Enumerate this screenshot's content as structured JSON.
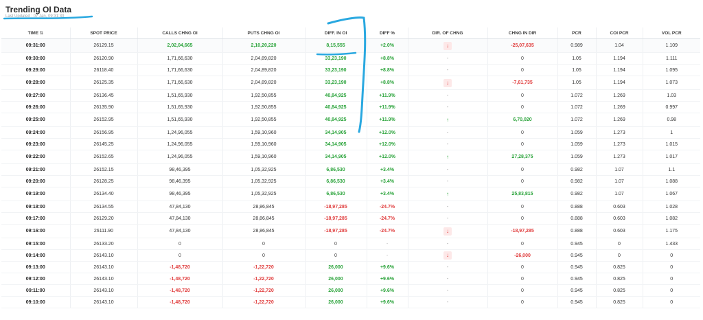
{
  "header": {
    "title": "Trending OI Data",
    "subtitle": "Last Updated : 07 Jan, 09:31:30"
  },
  "columns": [
    "TIME",
    "SPOT PRICE",
    "CALLS CHNG OI",
    "PUTS CHNG OI",
    "DIFF. IN OI",
    "DIFF %",
    "DIR. OF CHNG",
    "CHNG IN DIR",
    "PCR",
    "COI PCR",
    "VOL PCR"
  ],
  "icons": {
    "sort": "sort-icon",
    "down": "arrow-down-icon",
    "up": "arrow-up-icon"
  },
  "colors": {
    "positive": "#2aa33a",
    "negative": "#e03c3c",
    "annotation": "#29a8e0"
  },
  "rows": [
    {
      "time": "09:31:00",
      "spot": "26129.15",
      "calls": "2,02,04,665",
      "puts": "2,10,20,220",
      "diff": "8,15,555",
      "diffpct": "+2.0%",
      "dir": "down",
      "chng": "-25,07,635",
      "pcr": "0.989",
      "coi": "1.04",
      "vol": "1.109"
    },
    {
      "time": "09:30:00",
      "spot": "26120.90",
      "calls": "1,71,66,630",
      "puts": "2,04,89,820",
      "diff": "33,23,190",
      "diffpct": "+8.8%",
      "dir": "-",
      "chng": "0",
      "pcr": "1.05",
      "coi": "1.194",
      "vol": "1.111"
    },
    {
      "time": "09:29:00",
      "spot": "26118.40",
      "calls": "1,71,66,630",
      "puts": "2,04,89,820",
      "diff": "33,23,190",
      "diffpct": "+8.8%",
      "dir": "-",
      "chng": "0",
      "pcr": "1.05",
      "coi": "1.194",
      "vol": "1.095"
    },
    {
      "time": "09:28:00",
      "spot": "26125.35",
      "calls": "1,71,66,630",
      "puts": "2,04,89,820",
      "diff": "33,23,190",
      "diffpct": "+8.8%",
      "dir": "down",
      "chng": "-7,61,735",
      "pcr": "1.05",
      "coi": "1.194",
      "vol": "1.073"
    },
    {
      "time": "09:27:00",
      "spot": "26136.45",
      "calls": "1,51,65,930",
      "puts": "1,92,50,855",
      "diff": "40,84,925",
      "diffpct": "+11.9%",
      "dir": "-",
      "chng": "0",
      "pcr": "1.072",
      "coi": "1.269",
      "vol": "1.03"
    },
    {
      "time": "09:26:00",
      "spot": "26135.90",
      "calls": "1,51,65,930",
      "puts": "1,92,50,855",
      "diff": "40,84,925",
      "diffpct": "+11.9%",
      "dir": "-",
      "chng": "0",
      "pcr": "1.072",
      "coi": "1.269",
      "vol": "0.997"
    },
    {
      "time": "09:25:00",
      "spot": "26152.95",
      "calls": "1,51,65,930",
      "puts": "1,92,50,855",
      "diff": "40,84,925",
      "diffpct": "+11.9%",
      "dir": "up",
      "chng": "6,70,020",
      "pcr": "1.072",
      "coi": "1.269",
      "vol": "0.98"
    },
    {
      "time": "09:24:00",
      "spot": "26156.95",
      "calls": "1,24,96,055",
      "puts": "1,59,10,960",
      "diff": "34,14,905",
      "diffpct": "+12.0%",
      "dir": "-",
      "chng": "0",
      "pcr": "1.059",
      "coi": "1.273",
      "vol": "1"
    },
    {
      "time": "09:23:00",
      "spot": "26145.25",
      "calls": "1,24,96,055",
      "puts": "1,59,10,960",
      "diff": "34,14,905",
      "diffpct": "+12.0%",
      "dir": "-",
      "chng": "0",
      "pcr": "1.059",
      "coi": "1.273",
      "vol": "1.015"
    },
    {
      "time": "09:22:00",
      "spot": "26152.65",
      "calls": "1,24,96,055",
      "puts": "1,59,10,960",
      "diff": "34,14,905",
      "diffpct": "+12.0%",
      "dir": "up",
      "chng": "27,28,375",
      "pcr": "1.059",
      "coi": "1.273",
      "vol": "1.017"
    },
    {
      "time": "09:21:00",
      "spot": "26152.15",
      "calls": "98,46,395",
      "puts": "1,05,32,925",
      "diff": "6,86,530",
      "diffpct": "+3.4%",
      "dir": "-",
      "chng": "0",
      "pcr": "0.982",
      "coi": "1.07",
      "vol": "1.1"
    },
    {
      "time": "09:20:00",
      "spot": "26128.25",
      "calls": "98,46,395",
      "puts": "1,05,32,925",
      "diff": "6,86,530",
      "diffpct": "+3.4%",
      "dir": "-",
      "chng": "0",
      "pcr": "0.982",
      "coi": "1.07",
      "vol": "1.088"
    },
    {
      "time": "09:19:00",
      "spot": "26134.40",
      "calls": "98,46,395",
      "puts": "1,05,32,925",
      "diff": "6,86,530",
      "diffpct": "+3.4%",
      "dir": "up",
      "chng": "25,83,815",
      "pcr": "0.982",
      "coi": "1.07",
      "vol": "1.067"
    },
    {
      "time": "09:18:00",
      "spot": "26134.55",
      "calls": "47,84,130",
      "puts": "28,86,845",
      "diff": "-18,97,285",
      "diffpct": "-24.7%",
      "dir": "-",
      "chng": "0",
      "pcr": "0.888",
      "coi": "0.603",
      "vol": "1.028"
    },
    {
      "time": "09:17:00",
      "spot": "26129.20",
      "calls": "47,84,130",
      "puts": "28,86,845",
      "diff": "-18,97,285",
      "diffpct": "-24.7%",
      "dir": "-",
      "chng": "0",
      "pcr": "0.888",
      "coi": "0.603",
      "vol": "1.082"
    },
    {
      "time": "09:16:00",
      "spot": "26111.90",
      "calls": "47,84,130",
      "puts": "28,86,845",
      "diff": "-18,97,285",
      "diffpct": "-24.7%",
      "dir": "down",
      "chng": "-18,97,285",
      "pcr": "0.888",
      "coi": "0.603",
      "vol": "1.175"
    },
    {
      "time": "09:15:00",
      "spot": "26133.20",
      "calls": "0",
      "puts": "0",
      "diff": "0",
      "diffpct": "-",
      "dir": "-",
      "chng": "0",
      "pcr": "0.945",
      "coi": "0",
      "vol": "1.433"
    },
    {
      "time": "09:14:00",
      "spot": "26143.10",
      "calls": "0",
      "puts": "0",
      "diff": "0",
      "diffpct": "-",
      "dir": "down",
      "chng": "-26,000",
      "pcr": "0.945",
      "coi": "0",
      "vol": "0"
    },
    {
      "time": "09:13:00",
      "spot": "26143.10",
      "calls": "-1,48,720",
      "puts": "-1,22,720",
      "diff": "26,000",
      "diffpct": "+9.6%",
      "dir": "-",
      "chng": "0",
      "pcr": "0.945",
      "coi": "0.825",
      "vol": "0"
    },
    {
      "time": "09:12:00",
      "spot": "26143.10",
      "calls": "-1,48,720",
      "puts": "-1,22,720",
      "diff": "26,000",
      "diffpct": "+9.6%",
      "dir": "-",
      "chng": "0",
      "pcr": "0.945",
      "coi": "0.825",
      "vol": "0"
    },
    {
      "time": "09:11:00",
      "spot": "26143.10",
      "calls": "-1,48,720",
      "puts": "-1,22,720",
      "diff": "26,000",
      "diffpct": "+9.6%",
      "dir": "-",
      "chng": "0",
      "pcr": "0.945",
      "coi": "0.825",
      "vol": "0"
    },
    {
      "time": "09:10:00",
      "spot": "26143.10",
      "calls": "-1,48,720",
      "puts": "-1,22,720",
      "diff": "26,000",
      "diffpct": "+9.6%",
      "dir": "-",
      "chng": "0",
      "pcr": "0.945",
      "coi": "0.825",
      "vol": "0"
    }
  ]
}
